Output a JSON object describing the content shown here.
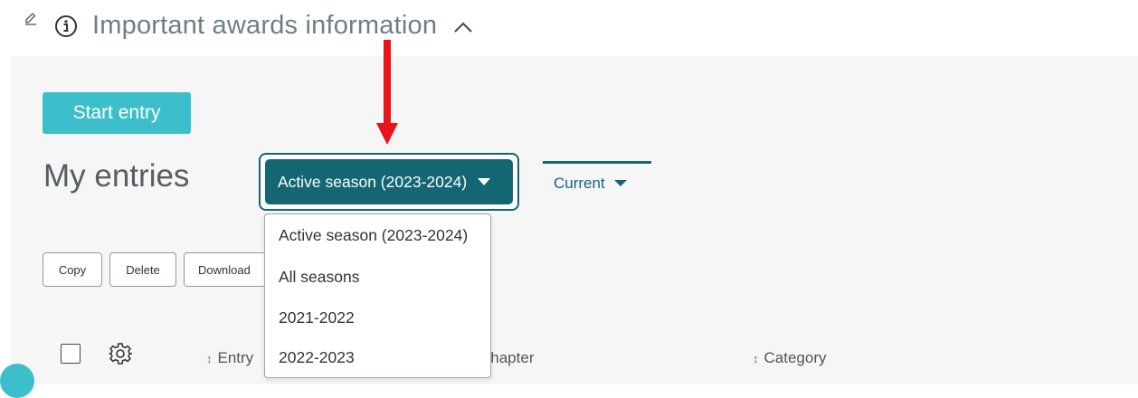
{
  "header": {
    "title": "Important awards information",
    "edit_icon": "pencil-icon",
    "info_icon": "info-icon",
    "toggle_icon": "chevron-up-icon"
  },
  "actions": {
    "start_entry_label": "Start entry"
  },
  "entries": {
    "title": "My entries",
    "season_select": {
      "selected": "Active season (2023-2024)",
      "options": [
        "Active season (2023-2024)",
        "All seasons",
        "2021-2022",
        "2022-2023"
      ]
    },
    "status_filter": {
      "selected": "Current"
    },
    "bulk_actions": [
      "Copy",
      "Delete",
      "Download"
    ],
    "table": {
      "columns": [
        "Entry",
        "Chapter",
        "Category"
      ],
      "settings_icon": "gear-icon"
    }
  },
  "annotation": {
    "arrow_color": "#e8141b"
  },
  "colors": {
    "primary": "#136672",
    "accent": "#3cbfca",
    "muted_text": "#6b7f88"
  }
}
